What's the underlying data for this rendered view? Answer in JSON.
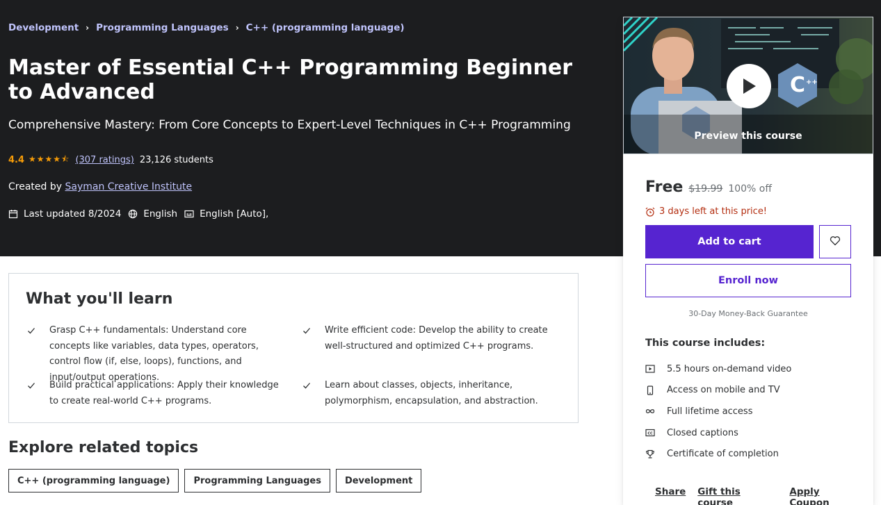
{
  "breadcrumb": [
    "Development",
    "Programming Languages",
    "C++ (programming language)"
  ],
  "course": {
    "title": "Master of Essential C++ Programming Beginner to Advanced",
    "subtitle": "Comprehensive Mastery: From Core Concepts to Expert-Level Techniques in C++ Programming",
    "rating": "4.4",
    "ratings_count": "(307 ratings)",
    "students": "23,126 students",
    "created_by_label": "Created by",
    "instructor": "Sayman Creative Institute",
    "last_updated": "Last updated 8/2024",
    "language": "English",
    "captions": "English [Auto],"
  },
  "learn": {
    "heading": "What you'll learn",
    "items": [
      "Grasp C++ fundamentals: Understand core concepts like variables, data types, operators, control flow (if, else, loops), functions, and input/output operations.",
      "Write efficient code: Develop the ability to create well-structured and optimized C++ programs.",
      "Build practical applications: Apply their knowledge to create real-world C++ programs.",
      "Learn about classes, objects, inheritance, polymorphism, encapsulation, and abstraction."
    ]
  },
  "explore": {
    "heading": "Explore related topics",
    "topics": [
      "C++ (programming language)",
      "Programming Languages",
      "Development"
    ]
  },
  "sidebar": {
    "preview_label": "Preview this course",
    "price": "Free",
    "old_price": "$19.99",
    "discount": "100% off",
    "timer": "3 days left at this price!",
    "add_to_cart": "Add to cart",
    "enroll": "Enroll now",
    "guarantee": "30-Day Money-Back Guarantee",
    "includes_title": "This course includes:",
    "includes": [
      {
        "icon": "video-icon",
        "label": "5.5 hours on-demand video"
      },
      {
        "icon": "mobile-icon",
        "label": "Access on mobile and TV"
      },
      {
        "icon": "infinity-icon",
        "label": "Full lifetime access"
      },
      {
        "icon": "captions-icon",
        "label": "Closed captions"
      },
      {
        "icon": "trophy-icon",
        "label": "Certificate of completion"
      }
    ],
    "links": [
      "Share",
      "Gift this course",
      "Apply Coupon"
    ]
  },
  "colors": {
    "hero_bg": "#1c1d1f",
    "accent_purple": "#5624d0",
    "link_lavender": "#c0c4fc",
    "star_orange": "#f69c08",
    "timer_red": "#b32d0f"
  }
}
